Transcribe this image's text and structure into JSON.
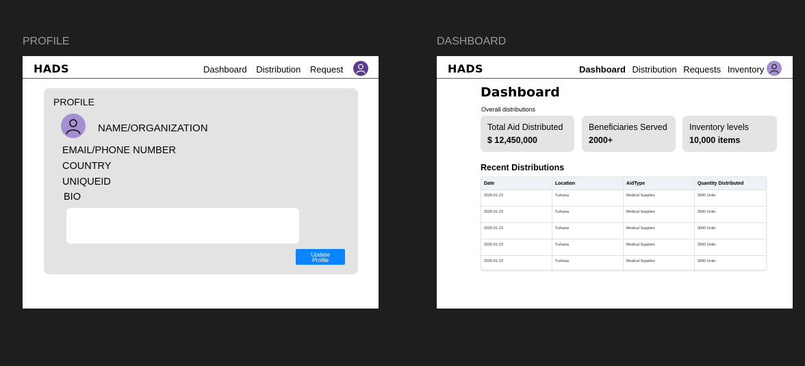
{
  "profile_frame": {
    "frame_label": "PROFILE",
    "nav": {
      "logo": "HADS",
      "links": [
        "Dashboard",
        "Distribution",
        "Request"
      ]
    },
    "card": {
      "title": "PROFILE",
      "name": "NAME/ORGANIZATION",
      "email": "EMAIL/PHONE NUMBER",
      "country": "COUNTRY",
      "uniqueid": "UNIQUEID",
      "bio": "BIO",
      "bio_value": "",
      "update_button_line1": "Update",
      "update_button_line2": "Profile"
    }
  },
  "dashboard_frame": {
    "frame_label": "DASHBOARD",
    "nav": {
      "logo": "HADS",
      "links": [
        "Dashboard",
        "Distribution",
        "Requests",
        "Inventory"
      ]
    },
    "title": "Dashboard",
    "subtitle": "Overall distributions",
    "stats": [
      {
        "label": "Total Aid Distributed",
        "value": "$ 12,450,000"
      },
      {
        "label": "Beneficiaries Served",
        "value": "2000+"
      },
      {
        "label": "Inventory levels",
        "value": "10,000 items"
      }
    ],
    "recent_title": "Recent Distributions",
    "table": {
      "headers": [
        "Date",
        "Location",
        "AidType",
        "Quantity Distributed"
      ],
      "rows": [
        [
          "2025-01-22",
          "Turkana",
          "Medical Supplies",
          "3000 Units"
        ],
        [
          "2025-01-22",
          "Turkana",
          "Medical Supplies",
          "3000 Units"
        ],
        [
          "2025-01-22",
          "Turkana",
          "Medical Supplies",
          "3000 Units"
        ],
        [
          "2025-01-22",
          "Turkana",
          "Medical Supplies",
          "3000 Units"
        ],
        [
          "2025-01-22",
          "Turkana",
          "Medical Supplies",
          "3000 Units"
        ]
      ]
    }
  },
  "colors": {
    "canvas": "#1e1e1e",
    "accent_button": "#0a84ff",
    "avatar_dark": "#5a3d8f",
    "avatar_light": "#a48fd0",
    "card_bg": "#e3e3e3"
  }
}
